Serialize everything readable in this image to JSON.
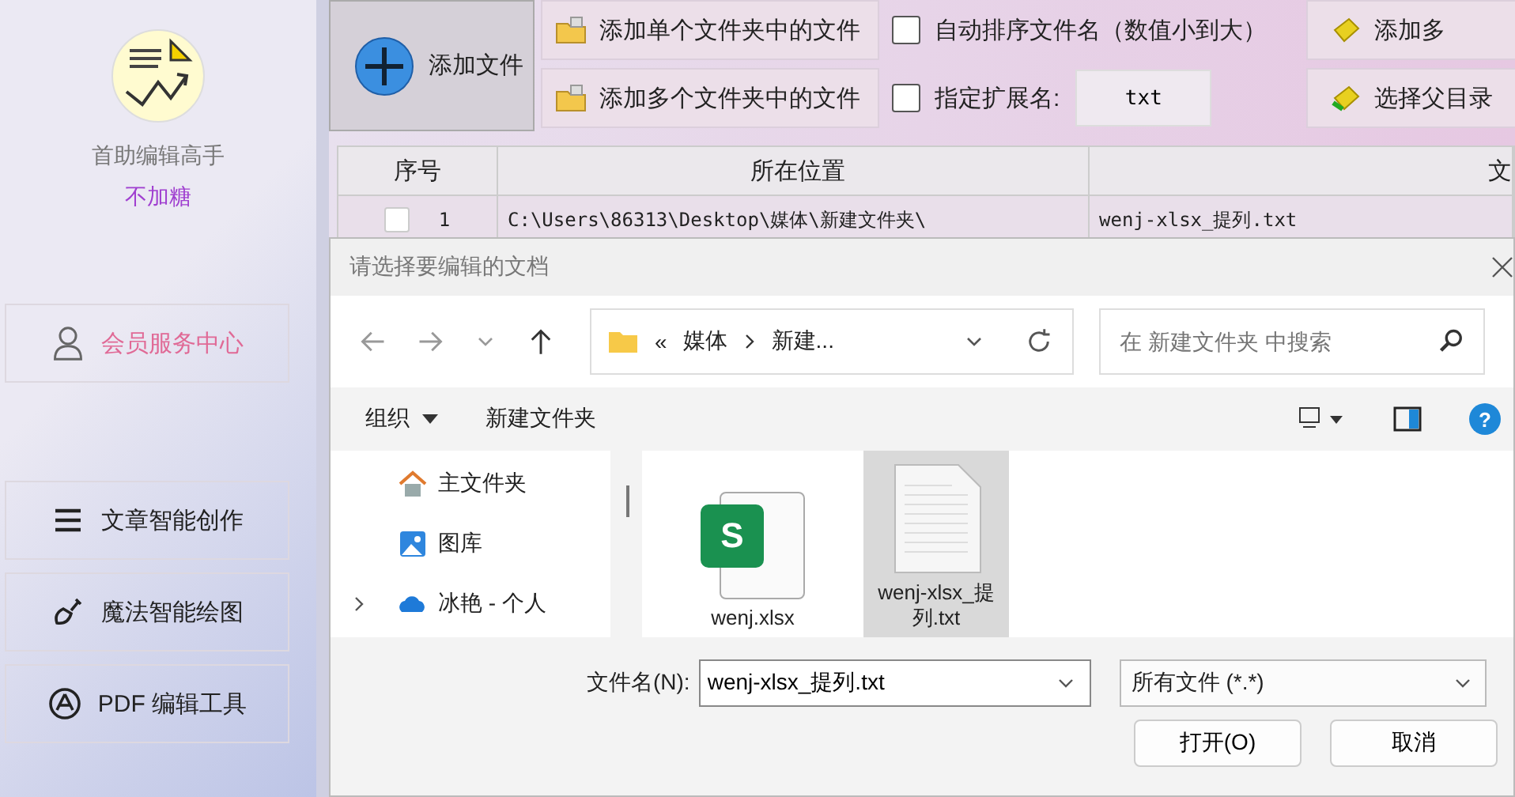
{
  "app": {
    "name": "首助编辑高手",
    "user": "不加糖",
    "member_button": "会员服务中心",
    "menu": [
      {
        "label": "文章智能创作"
      },
      {
        "label": "魔法智能绘图"
      },
      {
        "label": "PDF 编辑工具"
      }
    ]
  },
  "toolbar": {
    "add_file": "添加文件",
    "add_single": "添加单个文件夹中的文件",
    "add_multi": "添加多个文件夹中的文件",
    "auto_sort": {
      "label": "自动排序文件名（数值小到大）",
      "checked": false
    },
    "extension": {
      "label": "指定扩展名:",
      "checked": false,
      "value": "txt"
    },
    "right_buttons": [
      "添加多",
      "选择父目录"
    ]
  },
  "table": {
    "columns": [
      "序号",
      "所在位置",
      "文"
    ],
    "rows": [
      {
        "checked": false,
        "cells": [
          "1",
          "C:\\Users\\86313\\Desktop\\媒体\\新建文件夹\\",
          "wenj-xlsx_提列.txt"
        ]
      }
    ]
  },
  "dialog": {
    "title": "请选择要编辑的文档",
    "breadcrumbs": [
      "«",
      "媒体",
      "新建..."
    ],
    "search": {
      "placeholder": "在 新建文件夹 中搜索"
    },
    "commands": {
      "organize": "组织",
      "new_folder": "新建文件夹",
      "help": "?"
    },
    "nav": [
      {
        "label": "主文件夹"
      },
      {
        "label": "图库"
      },
      {
        "label": "冰艳 - 个人"
      }
    ],
    "files": [
      {
        "name": "wenj.xlsx",
        "kind": "sheet",
        "badge": "S",
        "selected": false
      },
      {
        "name": "wenj-xlsx_提列.txt",
        "kind": "text",
        "selected": true
      }
    ],
    "filename_label": "文件名(N):",
    "filename": "wenj-xlsx_提列.txt",
    "filetype": "所有文件 (*.*)",
    "buttons": [
      "打开(O)",
      "取消"
    ]
  }
}
